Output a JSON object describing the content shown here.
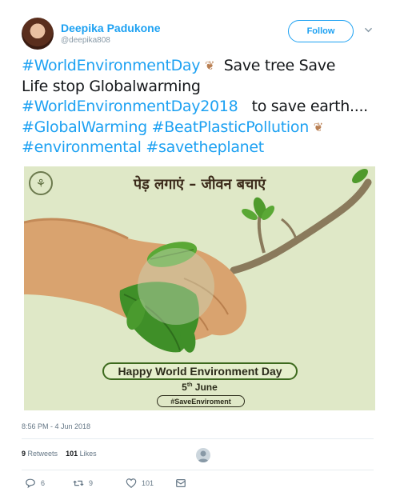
{
  "user": {
    "name": "Deepika Padukone",
    "handle": "@deepika808"
  },
  "follow_button": "Follow",
  "tweet": {
    "line1_tag": "#WorldEnvironmentDay",
    "line1_text": "  Save tree Save",
    "line2_text": "Life stop Globalwarming",
    "line3_tag": "#WorldEnvironmentDay2018",
    "line3_text": "   to save earth....",
    "line4_tag1": "#GlobalWarming",
    "line4_tag2": "#BeatPlasticPollution",
    "line5_tag1": "#environmental",
    "line5_tag2": "#savetheplanet",
    "emoji": "leaf-fluttering-emoji"
  },
  "media": {
    "hindi_title": "पेड़ लगाएं – जीवन बचाएं",
    "banner": "Happy World Environment Day",
    "date_day": "5",
    "date_suffix": "th",
    "date_month": " June",
    "hashtag": "#SaveEnviroment"
  },
  "meta": {
    "timestamp": "8:56 PM - 4 Jun 2018",
    "retweets_count": "9",
    "retweets_label": "Retweets",
    "likes_count": "101",
    "likes_label": "Likes"
  },
  "actions": {
    "replies": "6",
    "retweets": "9",
    "likes": "101"
  },
  "colors": {
    "link": "#1da1f2",
    "muted": "#657786",
    "image_bg": "#dfe8c7"
  }
}
